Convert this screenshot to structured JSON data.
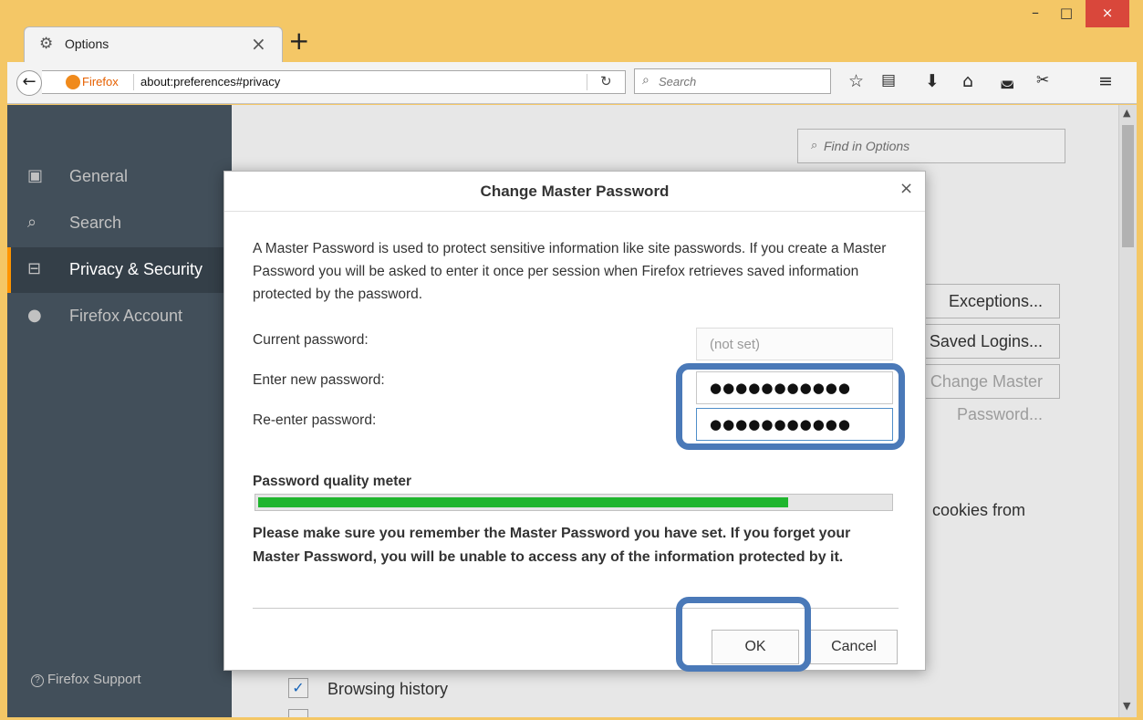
{
  "window": {
    "tab_title": "Options",
    "tab_icon": "gear-icon",
    "controls": {
      "minimize": "–",
      "maximize": "□",
      "close": "×"
    }
  },
  "navbar": {
    "identity_label": "Firefox",
    "url": "about:preferences#privacy",
    "search_placeholder": "Search"
  },
  "sidebar": {
    "items": [
      {
        "label": "General",
        "icon": "general-icon"
      },
      {
        "label": "Search",
        "icon": "search-icon"
      },
      {
        "label": "Privacy & Security",
        "icon": "lock-icon",
        "active": true
      },
      {
        "label": "Firefox Account",
        "icon": "account-icon"
      }
    ],
    "support_label": "Firefox Support"
  },
  "main": {
    "find_placeholder": "Find in Options",
    "buttons": {
      "exceptions": "Exceptions...",
      "saved_logins": "Saved Logins...",
      "master_password": "Change Master Password..."
    },
    "cookies_text": "cookies from",
    "browsing_history_label": "Browsing history"
  },
  "dialog": {
    "title": "Change Master Password",
    "description": "A Master Password is used to protect sensitive information like site passwords. If you create a Master Password you will be asked to enter it once per session when Firefox retrieves saved information protected by the password.",
    "current_label": "Current password:",
    "current_value": "(not set)",
    "new_label": "Enter new password:",
    "new_value": "●●●●●●●●●●●",
    "reenter_label": "Re-enter password:",
    "reenter_value": "●●●●●●●●●●●",
    "meter_label": "Password quality meter",
    "meter_fraction": 0.84,
    "warning": "Please make sure you remember the Master Password you have set. If you forget your Master Password, you will be unable to access any of the information protected by it.",
    "ok_label": "OK",
    "cancel_label": "Cancel"
  },
  "colors": {
    "titlebar": "#f4c766",
    "sidebar": "#424f5a",
    "accent": "#ff9500",
    "meter_fill": "#1fb52e",
    "highlight": "#4a79b8"
  }
}
